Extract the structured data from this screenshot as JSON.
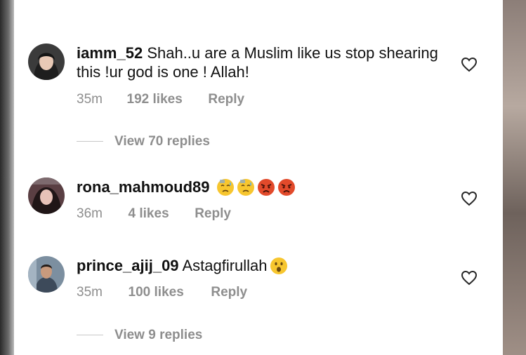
{
  "comments": [
    {
      "username": "iamm_52",
      "text": "Shah..u are a Muslim like us stop shearing this !ur god is one ! Allah!",
      "time": "35m",
      "likes": "192 likes",
      "reply_label": "Reply",
      "view_replies": "View 70 replies",
      "emojis": []
    },
    {
      "username": "rona_mahmoud89",
      "text": "",
      "time": "36m",
      "likes": "4 likes",
      "reply_label": "Reply",
      "emojis": [
        "sweat-emoji",
        "sweat-emoji",
        "angry-emoji",
        "angry-emoji"
      ]
    },
    {
      "username": "prince_ajij_09",
      "text": "Astagfirullah",
      "time": "35m",
      "likes": "100 likes",
      "reply_label": "Reply",
      "view_replies": "View 9 replies",
      "emojis": [
        "surprised-emoji"
      ]
    }
  ],
  "colors": {
    "text": "#111111",
    "secondary": "#8e8e8e",
    "background": "#ffffff",
    "emoji_yellow": "#f7c62f",
    "emoji_angry": "#e24a2b"
  }
}
